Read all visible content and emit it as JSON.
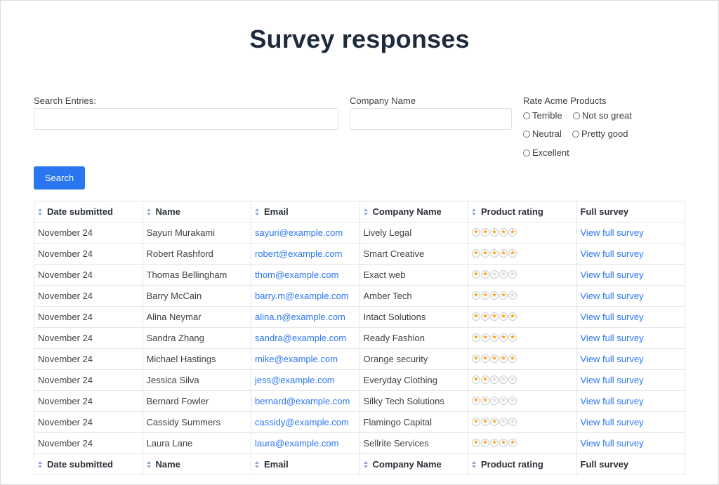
{
  "page": {
    "title": "Survey responses"
  },
  "filters": {
    "search_label": "Search Entries:",
    "search_value": "",
    "company_label": "Company Name",
    "company_value": "",
    "rating_label": "Rate Acme Products",
    "rating_options": [
      "Terrible",
      "Not so great",
      "Neutral",
      "Pretty good",
      "Excellent"
    ],
    "search_button": "Search"
  },
  "table": {
    "headers": [
      "Date submitted",
      "Name",
      "Email",
      "Company Name",
      "Product rating",
      "Full survey"
    ],
    "sortable": [
      true,
      true,
      true,
      true,
      true,
      false
    ],
    "rows": [
      {
        "date": "November 24",
        "name": "Sayuri Murakami",
        "email": "sayuri@example.com",
        "company": "Lively Legal",
        "rating": 5,
        "link": "View full survey"
      },
      {
        "date": "November 24",
        "name": "Robert Rashford",
        "email": "robert@example.com",
        "company": "Smart Creative",
        "rating": 5,
        "link": "View full survey"
      },
      {
        "date": "November 24",
        "name": "Thomas Bellingham",
        "email": "thom@example.com",
        "company": "Exact web",
        "rating": 2,
        "link": "View full survey"
      },
      {
        "date": "November 24",
        "name": "Barry McCain",
        "email": "barry.m@example.com",
        "company": "Amber Tech",
        "rating": 4,
        "link": "View full survey"
      },
      {
        "date": "November 24",
        "name": "Alina Neymar",
        "email": "alina.n@example.com",
        "company": "Intact Solutions",
        "rating": 5,
        "link": "View full survey"
      },
      {
        "date": "November 24",
        "name": "Sandra Zhang",
        "email": "sandra@example.com",
        "company": "Ready Fashion",
        "rating": 5,
        "link": "View full survey"
      },
      {
        "date": "November 24",
        "name": "Michael Hastings",
        "email": "mike@example.com",
        "company": "Orange security",
        "rating": 5,
        "link": "View full survey"
      },
      {
        "date": "November 24",
        "name": "Jessica Silva",
        "email": "jess@example.com",
        "company": "Everyday Clothing",
        "rating": 2,
        "link": "View full survey"
      },
      {
        "date": "November 24",
        "name": "Bernard Fowler",
        "email": "bernard@example.com",
        "company": "Silky Tech Solutions",
        "rating": 2,
        "link": "View full survey"
      },
      {
        "date": "November 24",
        "name": "Cassidy Summers",
        "email": "cassidy@example.com",
        "company": "Flamingo Capital",
        "rating": 3,
        "link": "View full survey"
      },
      {
        "date": "November 24",
        "name": "Laura Lane",
        "email": "laura@example.com",
        "company": "Sellrite Services",
        "rating": 5,
        "link": "View full survey"
      }
    ],
    "max_rating": 5
  },
  "icons": {
    "sort": "sort-icon",
    "star": "star-icon",
    "radio": "radio-icon"
  },
  "colors": {
    "accent": "#2a76f0",
    "title": "#1e2b3c",
    "star_on": "#f5a623",
    "star_off": "#d6d9dd"
  }
}
